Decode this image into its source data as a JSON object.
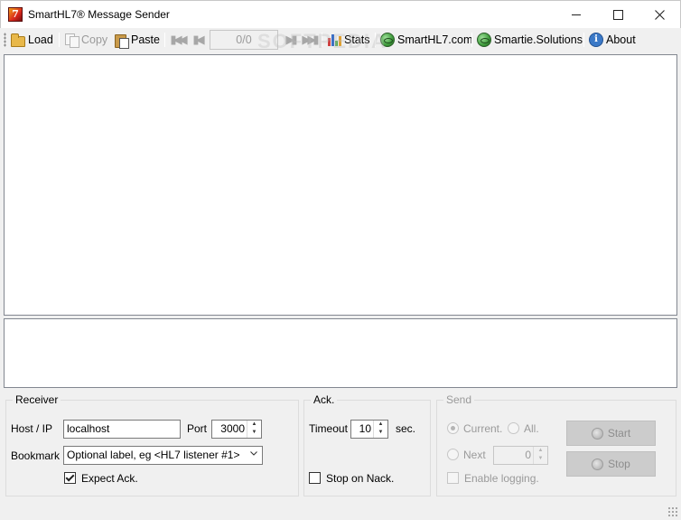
{
  "window": {
    "title": "SmartHL7® Message Sender",
    "icon_letter": "7",
    "controls": [
      "minimize-icon",
      "maximize-icon",
      "close-icon"
    ]
  },
  "toolbar": {
    "load_label": "Load",
    "copy_label": "Copy",
    "paste_label": "Paste",
    "counter": "0/0",
    "stats_label": "Stats",
    "site1_label": "SmartHL7.com",
    "site2_label": "Smartie.Solutions",
    "about_label": "About"
  },
  "watermark": "SOFTPEDIA",
  "receiver": {
    "title": "Receiver",
    "host_label": "Host / IP",
    "host_value": "localhost",
    "port_label": "Port",
    "port_value": "3000",
    "bookmark_label": "Bookmark",
    "bookmark_value": "Optional label, eg <HL7 listener #1>",
    "expect_ack_label": "Expect Ack.",
    "expect_ack_checked": true
  },
  "ack": {
    "title": "Ack.",
    "timeout_label": "Timeout",
    "timeout_value": "10",
    "timeout_unit": "sec.",
    "stop_on_nack_label": "Stop on Nack.",
    "stop_on_nack_checked": false
  },
  "send": {
    "title": "Send",
    "current_label": "Current.",
    "all_label": "All.",
    "next_label": "Next",
    "next_value": "0",
    "enable_logging_label": "Enable logging.",
    "start_label": "Start",
    "stop_label": "Stop"
  }
}
